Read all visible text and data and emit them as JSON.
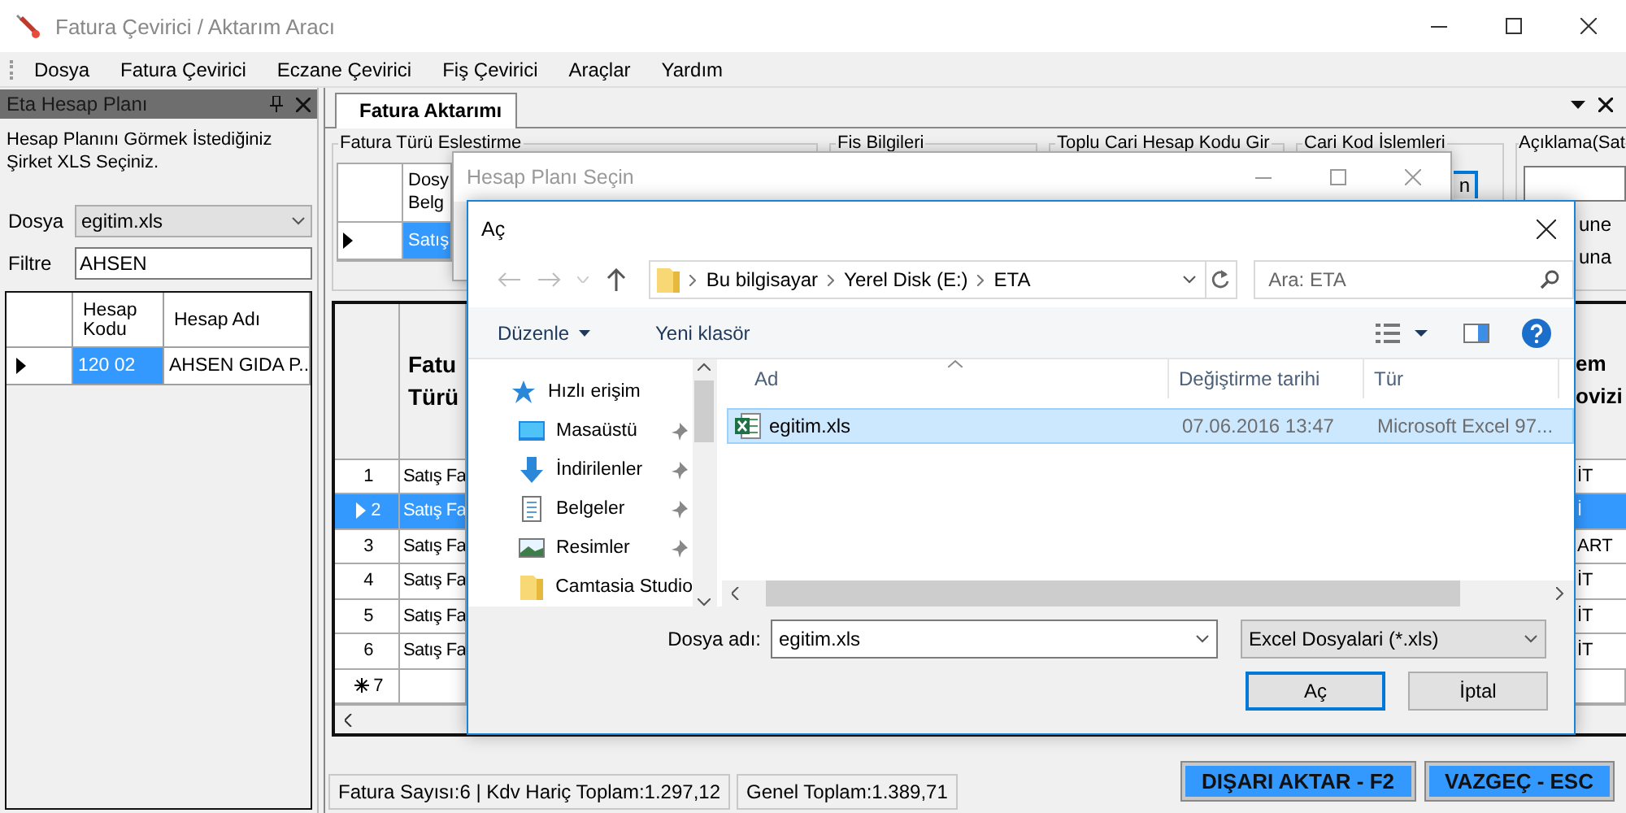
{
  "window": {
    "title": "Fatura Çevirici / Aktarım Aracı"
  },
  "menu": [
    {
      "label": "Dosya"
    },
    {
      "label": "Fatura Çevirici"
    },
    {
      "label": "Eczane Çevirici"
    },
    {
      "label": "Fiş Çevirici"
    },
    {
      "label": "Araçlar"
    },
    {
      "label": "Yardım"
    }
  ],
  "left_panel": {
    "title": "Eta Hesap Planı",
    "instruction": "Hesap Planını Görmek İstediğiniz Şirket XLS Seçiniz.",
    "file": {
      "label": "Dosya",
      "value": "egitim.xls"
    },
    "filter": {
      "label": "Filtre",
      "value": "AHSEN"
    },
    "table": {
      "columns": [
        "Hesap Kodu",
        "Hesap Adı"
      ],
      "rows": [
        {
          "cells": [
            "120 02",
            "AHSEN GIDA P..."
          ],
          "selected": true
        }
      ]
    }
  },
  "main": {
    "tabs": [
      {
        "label": "Fatura Aktarımı",
        "selected": true
      }
    ],
    "groups": [
      {
        "title": "Fatura Türü Eslestirme"
      },
      {
        "title": "Fis Bilgileri"
      },
      {
        "title": "Toplu Cari Hesap Kodu Gir"
      },
      {
        "title": "Cari Kod İslemleri"
      },
      {
        "title": "Açıklama(Sat"
      }
    ],
    "mapping": {
      "columns": [
        "Dosy Belg"
      ],
      "rows": [
        {
          "cells": [
            "Satış"
          ],
          "selected": true
        }
      ]
    },
    "cari_button": "n",
    "notes": [
      "une",
      "una"
    ],
    "grid": {
      "columns": [
        "Fatu Türü",
        "em ovizi"
      ],
      "rows": [
        {
          "kind": "data",
          "number": "1",
          "cells": [
            "Satış Fa",
            "İT"
          ],
          "selected": false
        },
        {
          "kind": "data",
          "number": "2",
          "cells": [
            "Satış Fa",
            "İ"
          ],
          "selected": true
        },
        {
          "kind": "data",
          "number": "3",
          "cells": [
            "Satış Fa",
            "ART"
          ],
          "selected": false
        },
        {
          "kind": "data",
          "number": "4",
          "cells": [
            "Satış Fa",
            "İT"
          ],
          "selected": false
        },
        {
          "kind": "data",
          "number": "5",
          "cells": [
            "Satış Fa",
            "İT"
          ],
          "selected": false
        },
        {
          "kind": "data",
          "number": "6",
          "cells": [
            "Satış Fa",
            "İT"
          ],
          "selected": false
        },
        {
          "kind": "new",
          "number": "7",
          "selected": false
        }
      ]
    },
    "status_bar": [
      "Fatura Sayısı:6 | Kdv Hariç Toplam:1.297,12",
      "Genel Toplam:1.389,71"
    ],
    "buttons": [
      "DIŞARI AKTAR - F2",
      "VAZGEÇ - ESC"
    ]
  },
  "back_dialog": {
    "title": "Hesap Planı Seçin"
  },
  "open_dialog": {
    "title": "Aç",
    "path": [
      "Bu bilgisayar",
      "Yerel Disk (E:)",
      "ETA"
    ],
    "search": {
      "placeholder": "Ara: ETA"
    },
    "toolbar": [
      "Düzenle",
      "Yeni klasör"
    ],
    "nav": [
      {
        "kind": "star",
        "label": "Hızlı erişim",
        "pinned": false
      },
      {
        "kind": "desktop",
        "label": "Masaüstü",
        "pinned": true
      },
      {
        "kind": "download",
        "label": "İndirilenler",
        "pinned": true
      },
      {
        "kind": "document",
        "label": "Belgeler",
        "pinned": true
      },
      {
        "kind": "image",
        "label": "Resimler",
        "pinned": true
      },
      {
        "kind": "folder",
        "label": "Camtasia Studio",
        "pinned": false
      }
    ],
    "columns": [
      "Ad",
      "Değiştirme tarihi",
      "Tür"
    ],
    "files": [
      {
        "name": "egitim.xls",
        "date": "07.06.2016 13:47",
        "type": "Microsoft Excel 97...",
        "selected": true
      }
    ],
    "filename": {
      "label": "Dosya adı:",
      "value": "egitim.xls"
    },
    "filetype": "Excel Dosyalari (*.xls)",
    "buttons": [
      {
        "label": "Aç",
        "default": true
      },
      {
        "label": "İptal",
        "default": false
      }
    ]
  }
}
